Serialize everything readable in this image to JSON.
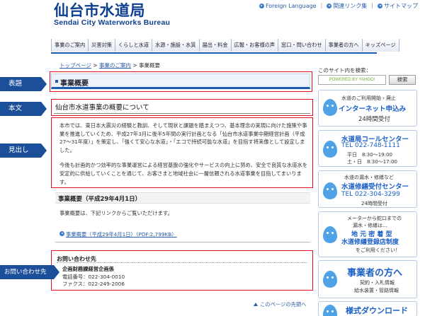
{
  "header": {
    "logo_ja": "仙台市水道局",
    "logo_en": "Sendai City Waterworks Bureau",
    "util_links": [
      "Foreign Language",
      "関連リンク集",
      "サイトマップ"
    ],
    "util_sep": "|"
  },
  "nav": {
    "items": [
      "事業のご案内",
      "災害対策",
      "くらしと水道",
      "水源・施設・水質",
      "届出・料金",
      "広報・お客様の声",
      "窓口・問い合わせ",
      "事業者の方へ",
      "キッズページ"
    ]
  },
  "breadcrumb": {
    "items": [
      "トップページ",
      "事業のご案内",
      "事業概要"
    ],
    "separator": ">"
  },
  "main": {
    "page_title": "事業概要",
    "heading": "仙台市水道事業の概要について",
    "paragraphs": [
      "本市では、東日本大震災の経験と教訓、そして現状と課題を踏まえつつ、基本理念の実現に向けた施策や事業を推進していくため、平成27年3月に後半5年間の実行計画となる「仙台市水道事業中期経営計画（平成27～31年度）」を策定し、「強くて安心な水道」・「エコで持続可能な水道」を目指す将来像として設定しました。",
      "今後も計画的かつ効率的な事業運営による経営基盤の強化やサービスの向上に努め、安全で良質な水道水を安定的に供給していくことを通じて、お客さまと地域社会に一層信頼される水道事業を目指してまいります。"
    ],
    "section_heading": "事業概要（平成29年4月1日）",
    "section_text": "事業概要は、下記リンクからご覧いただけます。",
    "pdf_link": "事業概要（平成29年4月1日）（PDF:2,799KB）",
    "contact": {
      "title": "お問い合わせ先",
      "dept": "企画財務課経営企画係",
      "tel": "電話番号：022-304-0010",
      "fax": "ファクス：022-249-2006"
    },
    "page_top": "このページの先頭へ"
  },
  "labels": {
    "title": "表題",
    "body": "本文",
    "heading": "見出し",
    "contact": "お問い合わせ先"
  },
  "sidebar": {
    "search_label": "このサイト内を検索：",
    "search_placeholder": "POWERED BY YAHOO!",
    "search_button": "検索",
    "banners": [
      {
        "line1": "水道のご利用開始・廃止",
        "line2": "インターネット申込み",
        "line3": "24時間受付"
      },
      {
        "line1": "水道局コールセンター",
        "line2": "TEL 022-748-1111",
        "line3": "平日　8:30～19:00",
        "line4": "土・日　8:30～17:00"
      },
      {
        "line1": "水道の漏水・修繕など",
        "line2": "水道修繕受付センター",
        "line3": "TEL 022-304-3299",
        "line4": "24時間受付"
      },
      {
        "line1": "メーターから蛇口までの",
        "line2": "漏水・修繕は…",
        "line3": "地 元 密 着 型",
        "line4": "水道修繕登録店制度",
        "line5": "をご利用ください！"
      },
      {
        "line1": "事業者の方へ",
        "line2": "契約・入札情報",
        "line3": "給水装置・管路情報"
      },
      {
        "line1": "様式ダウンロード"
      }
    ]
  },
  "colors": {
    "brand_blue": "#0e3f8f",
    "accent_blue": "#1d5bb0",
    "annotation_red": "#e01020",
    "link_blue": "#2a5ca8"
  }
}
